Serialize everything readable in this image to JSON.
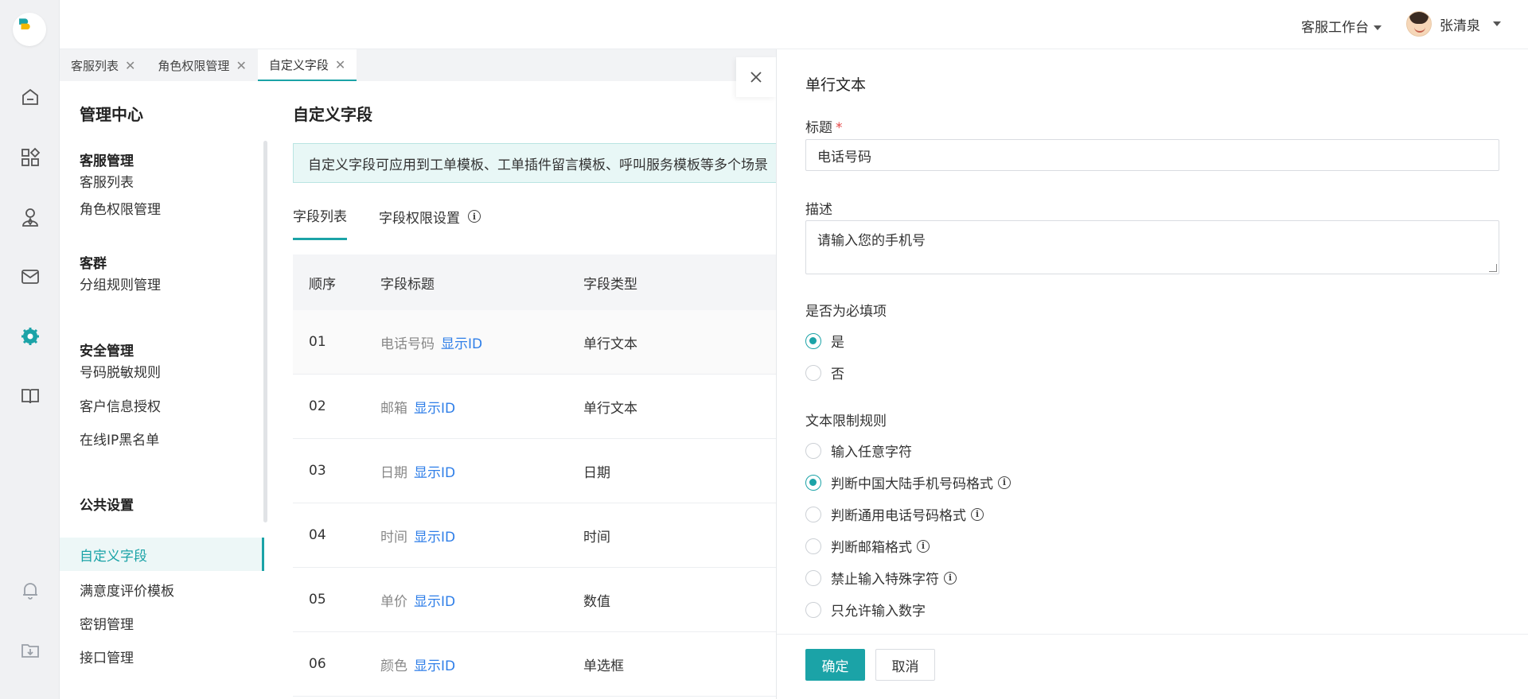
{
  "colors": {
    "accent": "#1ba3a7",
    "link": "#2e7ee8",
    "required": "#e54545",
    "notice_bg": "#e8f7f6"
  },
  "rail": {
    "icons": [
      "logo-icon",
      "home-icon",
      "apps-icon",
      "customer-icon",
      "mail-icon",
      "settings-gear-icon",
      "book-icon",
      "bell-icon",
      "download-icon"
    ],
    "active": "settings-gear-icon"
  },
  "topbar": {
    "workbench": "客服工作台",
    "user_name": "张清泉"
  },
  "tabs": [
    {
      "label": "客服列表",
      "close": "✕"
    },
    {
      "label": "角色权限管理",
      "close": "✕"
    },
    {
      "label": "自定义字段",
      "close": "✕",
      "active": true
    }
  ],
  "menu": {
    "title": "管理中心",
    "groups": [
      {
        "title": "客服管理",
        "items": [
          "客服列表",
          "角色权限管理"
        ]
      },
      {
        "title": "客群",
        "items": [
          "分组规则管理"
        ]
      },
      {
        "title": "安全管理",
        "items": [
          "号码脱敏规则",
          "客户信息授权",
          "在线IP黑名单"
        ]
      },
      {
        "title": "公共设置",
        "items": [
          "自定义字段",
          "满意度评价模板",
          "密钥管理",
          "接口管理"
        ]
      }
    ],
    "active_item": "自定义字段"
  },
  "main": {
    "title": "自定义字段",
    "notice": "自定义字段可应用到工单模板、工单插件留言模板、呼叫服务模板等多个场景",
    "subtabs": [
      "字段列表",
      "字段权限设置"
    ],
    "table": {
      "headers": [
        "顺序",
        "字段标题",
        "字段类型"
      ],
      "id_link": "显示ID",
      "rows": [
        {
          "order": "01",
          "name": "电话号码",
          "type": "单行文本"
        },
        {
          "order": "02",
          "name": "邮箱",
          "type": "单行文本"
        },
        {
          "order": "03",
          "name": "日期",
          "type": "日期"
        },
        {
          "order": "04",
          "name": "时间",
          "type": "时间"
        },
        {
          "order": "05",
          "name": "单价",
          "type": "数值"
        },
        {
          "order": "06",
          "name": "颜色",
          "type": "单选框"
        }
      ]
    }
  },
  "drawer": {
    "close": "✕",
    "title": "单行文本",
    "field_title_label": "标题",
    "required_mark": "*",
    "field_title_value": "电话号码",
    "desc_label": "描述",
    "desc_value": "请输入您的手机号",
    "required_label": "是否为必填项",
    "required_options": [
      {
        "label": "是",
        "checked": true
      },
      {
        "label": "否",
        "checked": false
      }
    ],
    "rule_label": "文本限制规则",
    "rule_options": [
      {
        "label": "输入任意字符",
        "checked": false,
        "info": false
      },
      {
        "label": "判断中国大陆手机号码格式",
        "checked": true,
        "info": true
      },
      {
        "label": "判断通用电话号码格式",
        "checked": false,
        "info": true
      },
      {
        "label": "判断邮箱格式",
        "checked": false,
        "info": true
      },
      {
        "label": "禁止输入特殊字符",
        "checked": false,
        "info": true
      },
      {
        "label": "只允许输入数字",
        "checked": false,
        "info": false
      }
    ],
    "info_glyph": "i",
    "confirm": "确定",
    "cancel": "取消"
  }
}
